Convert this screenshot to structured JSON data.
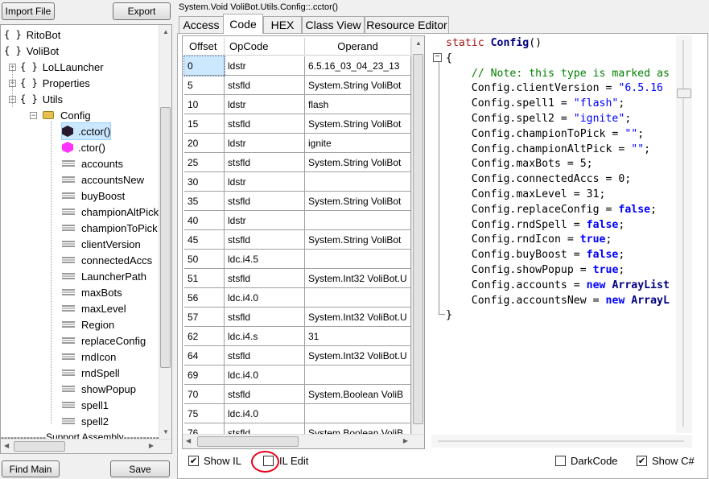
{
  "left": {
    "import_label": "Import File",
    "export_label": "Export",
    "find_main_label": "Find Main",
    "save_label": "Save",
    "tree": [
      {
        "label": "RitoBot",
        "kind": "ns"
      },
      {
        "label": "VoliBot",
        "kind": "ns"
      },
      {
        "label": "LoLLauncher",
        "kind": "ns"
      },
      {
        "label": "Properties",
        "kind": "ns"
      },
      {
        "label": "Utils",
        "kind": "ns"
      },
      {
        "label": "Config",
        "kind": "class"
      },
      {
        "label": ".cctor()",
        "kind": "cctor"
      },
      {
        "label": ".ctor()",
        "kind": "ctor"
      },
      {
        "label": "accounts",
        "kind": "field"
      },
      {
        "label": "accountsNew",
        "kind": "field"
      },
      {
        "label": "buyBoost",
        "kind": "field"
      },
      {
        "label": "championAltPick",
        "kind": "field"
      },
      {
        "label": "championToPick",
        "kind": "field"
      },
      {
        "label": "clientVersion",
        "kind": "field"
      },
      {
        "label": "connectedAccs",
        "kind": "field"
      },
      {
        "label": "LauncherPath",
        "kind": "field"
      },
      {
        "label": "maxBots",
        "kind": "field"
      },
      {
        "label": "maxLevel",
        "kind": "field"
      },
      {
        "label": "Region",
        "kind": "field"
      },
      {
        "label": "replaceConfig",
        "kind": "field"
      },
      {
        "label": "rndIcon",
        "kind": "field"
      },
      {
        "label": "rndSpell",
        "kind": "field"
      },
      {
        "label": "showPopup",
        "kind": "field"
      },
      {
        "label": "spell1",
        "kind": "field"
      },
      {
        "label": "spell2",
        "kind": "field"
      },
      {
        "label": "--------------Support Assembly--------------",
        "kind": "separator"
      }
    ]
  },
  "right": {
    "title": "System.Void VoliBot.Utils.Config::.cctor()",
    "tabs": [
      "Access",
      "Code",
      "HEX",
      "Class View",
      "Resource Editor"
    ],
    "active_tab": "Code",
    "il_headers": [
      "Offset",
      "OpCode",
      "Operand"
    ],
    "il_rows": [
      [
        "0",
        "ldstr",
        "6.5.16_03_04_23_13"
      ],
      [
        "5",
        "stsfld",
        "System.String VoliBot"
      ],
      [
        "10",
        "ldstr",
        "flash"
      ],
      [
        "15",
        "stsfld",
        "System.String VoliBot"
      ],
      [
        "20",
        "ldstr",
        "ignite"
      ],
      [
        "25",
        "stsfld",
        "System.String VoliBot"
      ],
      [
        "30",
        "ldstr",
        ""
      ],
      [
        "35",
        "stsfld",
        "System.String VoliBot"
      ],
      [
        "40",
        "ldstr",
        ""
      ],
      [
        "45",
        "stsfld",
        "System.String VoliBot"
      ],
      [
        "50",
        "ldc.i4.5",
        ""
      ],
      [
        "51",
        "stsfld",
        "System.Int32 VoliBot.U"
      ],
      [
        "56",
        "ldc.i4.0",
        ""
      ],
      [
        "57",
        "stsfld",
        "System.Int32 VoliBot.U"
      ],
      [
        "62",
        "ldc.i4.s",
        "31"
      ],
      [
        "64",
        "stsfld",
        "System.Int32 VoliBot.U"
      ],
      [
        "69",
        "ldc.i4.0",
        ""
      ],
      [
        "70",
        "stsfld",
        "System.Boolean VoliB"
      ],
      [
        "75",
        "ldc.i4.0",
        ""
      ],
      [
        "76",
        "stsfld",
        "System.Boolean VoliB"
      ]
    ],
    "code_lines": [
      "static Config()",
      "{",
      "    // Note: this type is marked as",
      "    Config.clientVersion = \"6.5.16",
      "    Config.spell1 = \"flash\";",
      "    Config.spell2 = \"ignite\";",
      "    Config.championToPick = \"\";",
      "    Config.championAltPick = \"\";",
      "    Config.maxBots = 5;",
      "    Config.connectedAccs = 0;",
      "    Config.maxLevel = 31;",
      "    Config.replaceConfig = false;",
      "    Config.rndSpell = false;",
      "    Config.rndIcon = true;",
      "    Config.buyBoost = false;",
      "    Config.showPopup = true;",
      "    Config.accounts = new ArrayList",
      "    Config.accountsNew = new ArrayL",
      "}"
    ],
    "show_il_label": "Show IL",
    "il_edit_label": "IL Edit",
    "dark_code_label": "DarkCode",
    "show_cs_label": "Show C#",
    "show_il_checked": true,
    "il_edit_checked": false,
    "dark_code_checked": false,
    "show_cs_checked": true,
    "highlight_color": "#e8001c",
    "selection_color": "#cce8ff"
  }
}
